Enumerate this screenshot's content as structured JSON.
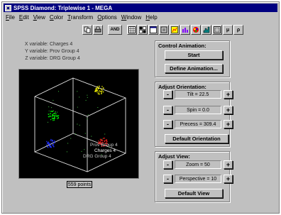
{
  "window": {
    "title": "SPSS Diamond: Triplewise  1 - MEGA"
  },
  "menu": [
    "File",
    "Edit",
    "View",
    "Color",
    "Transform",
    "Options",
    "Window",
    "Help"
  ],
  "toolbar": {
    "and_label": "AND",
    "mu_label": "μ",
    "rho_label": "ρ"
  },
  "variables": {
    "x_label": "X variable:",
    "x_value": "Charges 4",
    "y_label": "Y variable:",
    "y_value": "Prov Group 4",
    "z_label": "Z variable:",
    "z_value": "DRG Group 4"
  },
  "plot": {
    "axis_labels": [
      "Prov Group 4",
      "Charges 4",
      "DRG Group 4"
    ],
    "point_count": "559 points",
    "clusters": [
      {
        "color": "#ffff00"
      },
      {
        "color": "#00ff00"
      },
      {
        "color": "#ff2020"
      },
      {
        "color": "#2030ff"
      }
    ]
  },
  "control_animation": {
    "title": "Control Animation:",
    "start_label": "Start",
    "define_label": "Define Animation..."
  },
  "orientation": {
    "title": "Adjust Orientation:",
    "tilt": "Tilt = 22.5",
    "spin": "Spin = 0.0",
    "precess": "Precess = 309.4",
    "minus": "-",
    "plus": "+",
    "default_label": "Default Orientation"
  },
  "view": {
    "title": "Adjust View:",
    "zoom": "Zoom = 50",
    "perspective": "Perspective = 10",
    "minus": "-",
    "plus": "+",
    "default_label": "Default View"
  }
}
